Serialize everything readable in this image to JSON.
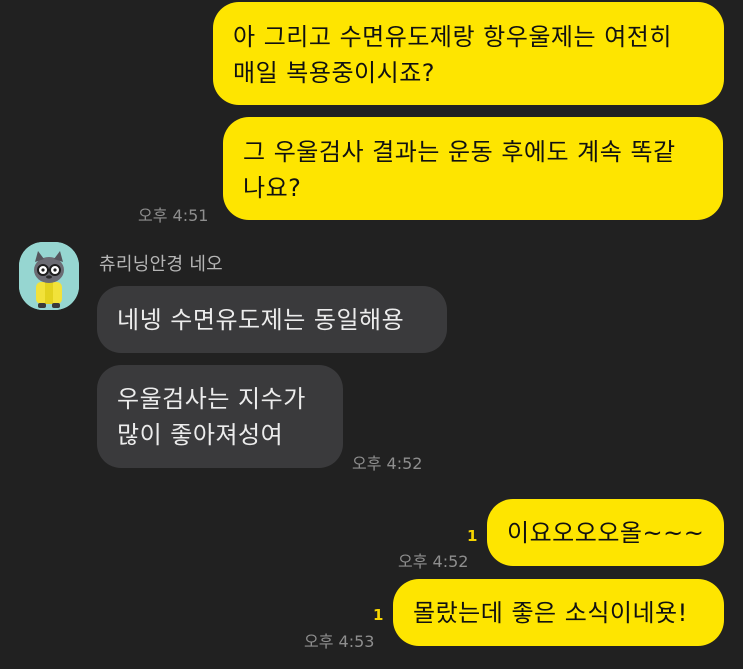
{
  "messages": [
    {
      "from": "me",
      "lines": [
        "아 그리고 수면유도제랑 항우울제는 여전히",
        "매일 복용중이시죠?"
      ]
    },
    {
      "from": "me",
      "lines": [
        "그 우울검사 결과는 운동 후에도 계속 똑같",
        "나요?"
      ],
      "time": "오후 4:51"
    },
    {
      "from": "other",
      "sender": "츄리닝안경 네오",
      "avatar_icon": "neo-character-avatar",
      "lines": [
        "네넹 수면유도제는 동일해용"
      ]
    },
    {
      "from": "other",
      "lines": [
        "우울검사는 지수가",
        "많이 좋아져성여"
      ],
      "time": "오후 4:52"
    },
    {
      "from": "me",
      "lines": [
        "이요오오오올~~~"
      ],
      "unread": "1",
      "time": "오후 4:52"
    },
    {
      "from": "me",
      "lines": [
        "몰랐는데 좋은 소식이네욧!"
      ],
      "unread": "1",
      "time": "오후 4:53"
    }
  ],
  "colors": {
    "background": "#212121",
    "my_bubble": "#fee500",
    "their_bubble": "#3a3a3c",
    "unread_count": "#f5d400",
    "timestamp": "#8e8e8e"
  }
}
